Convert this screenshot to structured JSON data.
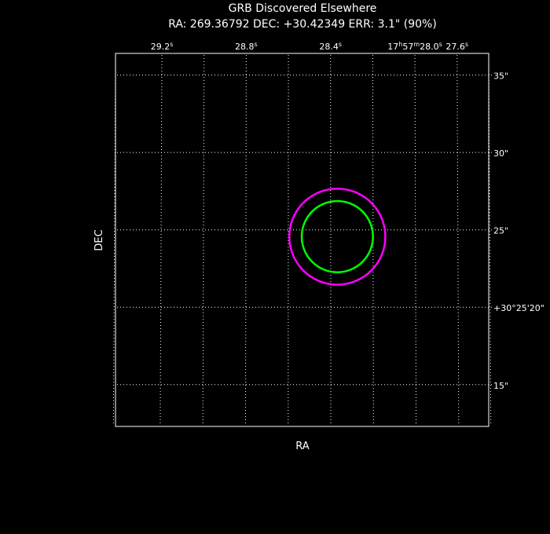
{
  "title": "GRB Discovered Elsewhere",
  "subtitle": "RA: 269.36792   DEC: +30.42349   ERR: 3.1\" (90%)",
  "chart_data": {
    "type": "scatter",
    "title": "GRB Discovered Elsewhere",
    "subtitle": "RA: 269.36792   DEC: +30.42349   ERR: 3.1\" (90%)",
    "xlabel": "RA",
    "ylabel": "DEC",
    "x_unit": "seconds of RA offset (relative to 17h57m28.0s)",
    "y_unit": "arcseconds (relative to +30°25'00\")",
    "xlim": [
      1.42,
      -0.35
    ],
    "ylim": [
      12.3,
      36.4
    ],
    "x_reversed": true,
    "grid": true,
    "grid_color": "#ffffff",
    "x_ticks": [
      {
        "value": 1.2,
        "label": "29.2",
        "sup": "s"
      },
      {
        "value": 0.8,
        "label": "28.8",
        "sup": "s"
      },
      {
        "value": 0.4,
        "label": "28.4",
        "sup": "s"
      },
      {
        "value": 0.0,
        "label": "17h57m28.0s",
        "parts": [
          [
            "17",
            ""
          ],
          [
            "h",
            "sup"
          ],
          [
            "57",
            ""
          ],
          [
            "m",
            "sup"
          ],
          [
            "28.0",
            ""
          ],
          [
            "s",
            "sup"
          ]
        ]
      },
      {
        "value": -0.2,
        "label": "27.6",
        "sup": "s"
      }
    ],
    "x_grid": [
      1.42,
      1.2,
      1.0,
      0.8,
      0.6,
      0.4,
      0.2,
      0.0,
      -0.2,
      -0.35
    ],
    "y_ticks": [
      {
        "value": 35,
        "label": "35\""
      },
      {
        "value": 30,
        "label": "30\""
      },
      {
        "value": 25,
        "label": "25\""
      },
      {
        "value": 20,
        "label": "+30°25'20\""
      },
      {
        "value": 15,
        "label": "15\""
      }
    ],
    "circles": [
      {
        "name": "outer",
        "ra": 0.3679,
        "dec": 24.56,
        "radius_arcsec": 3.1,
        "color": "#ff00ff"
      },
      {
        "name": "inner",
        "ra": 0.3679,
        "dec": 24.56,
        "radius_arcsec": 2.3,
        "color": "#00ff00"
      }
    ]
  }
}
